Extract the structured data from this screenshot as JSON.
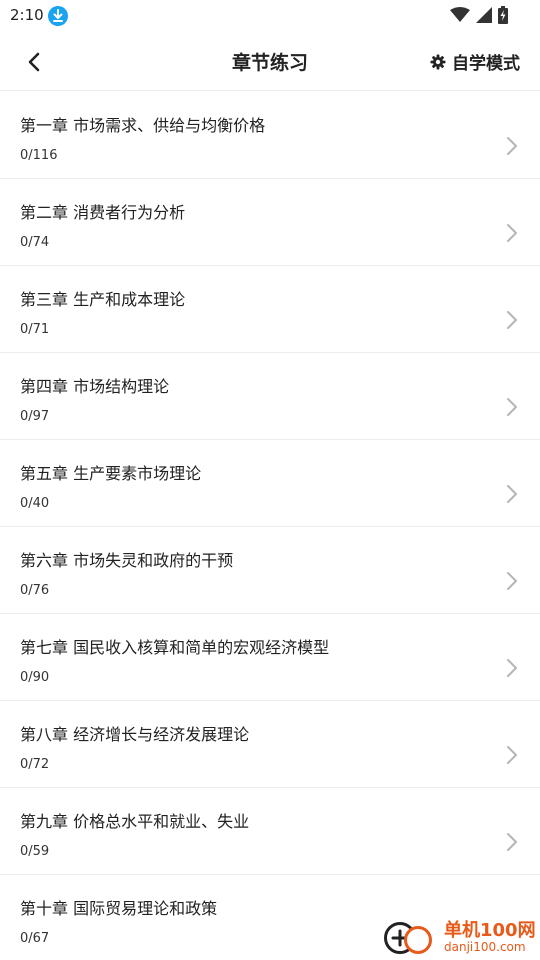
{
  "status_bar": {
    "time": "2:10"
  },
  "header": {
    "title": "章节练习",
    "mode_label": "自学模式"
  },
  "chapters": [
    {
      "title": "第一章 市场需求、供给与均衡价格",
      "progress": "0/116"
    },
    {
      "title": "第二章 消费者行为分析",
      "progress": "0/74"
    },
    {
      "title": "第三章 生产和成本理论",
      "progress": "0/71"
    },
    {
      "title": "第四章 市场结构理论",
      "progress": "0/97"
    },
    {
      "title": "第五章 生产要素市场理论",
      "progress": "0/40"
    },
    {
      "title": "第六章 市场失灵和政府的干预",
      "progress": "0/76"
    },
    {
      "title": "第七章 国民收入核算和简单的宏观经济模型",
      "progress": "0/90"
    },
    {
      "title": "第八章 经济增长与经济发展理论",
      "progress": "0/72"
    },
    {
      "title": "第九章 价格总水平和就业、失业",
      "progress": "0/59"
    },
    {
      "title": "第十章 国际贸易理论和政策",
      "progress": "0/67"
    }
  ],
  "watermark": {
    "name": "单机100网",
    "url": "danji100.com"
  },
  "colors": {
    "accent": "#1aa3f0",
    "watermark": "#e85a1a",
    "divider": "#ececec"
  }
}
